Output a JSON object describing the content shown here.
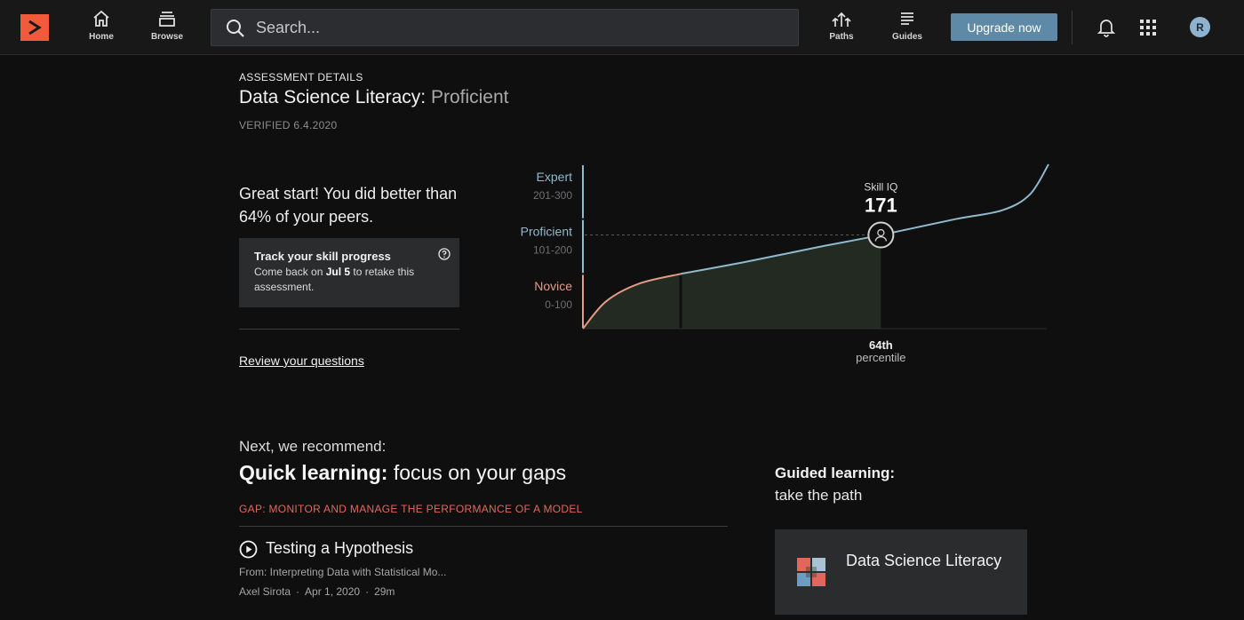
{
  "nav": {
    "home_label": "Home",
    "browse_label": "Browse",
    "paths_label": "Paths",
    "guides_label": "Guides",
    "upgrade_label": "Upgrade now",
    "avatar_initial": "R"
  },
  "search": {
    "placeholder": "Search..."
  },
  "assessment": {
    "eyebrow": "ASSESSMENT DETAILS",
    "skill_name": "Data Science Literacy:",
    "level": "Proficient",
    "verified": "VERIFIED 6.4.2020",
    "summary_prefix": "Great start! You did better than ",
    "summary_percent": "64%",
    "summary_suffix": " of your peers.",
    "track_title": "Track your skill progress",
    "track_body_prefix": "Come back on ",
    "track_date": "Jul 5",
    "track_body_suffix": " to retake this assessment.",
    "review_link": "Review your questions"
  },
  "chart_data": {
    "type": "line",
    "title": "",
    "bands": [
      {
        "name": "Expert",
        "range": "201-300",
        "color": "#8fb9cc"
      },
      {
        "name": "Proficient",
        "range": "101-200",
        "color": "#8fb9cc"
      },
      {
        "name": "Novice",
        "range": "0-100",
        "color": "#e39a86"
      }
    ],
    "marker_label": "Skill IQ",
    "skill_iq": 171,
    "percentile_value": "64th",
    "percentile_label": "percentile",
    "percentile": 64,
    "y_range": [
      0,
      300
    ],
    "x_range": [
      0,
      100
    ],
    "curve": [
      {
        "percentile": 0,
        "skill_iq": 0
      },
      {
        "percentile": 5,
        "skill_iq": 50
      },
      {
        "percentile": 12,
        "skill_iq": 82
      },
      {
        "percentile": 21,
        "skill_iq": 100
      },
      {
        "percentile": 35,
        "skill_iq": 122
      },
      {
        "percentile": 50,
        "skill_iq": 148
      },
      {
        "percentile": 64,
        "skill_iq": 171
      },
      {
        "percentile": 80,
        "skill_iq": 200
      },
      {
        "percentile": 90,
        "skill_iq": 216
      },
      {
        "percentile": 96,
        "skill_iq": 245
      },
      {
        "percentile": 100,
        "skill_iq": 300
      }
    ]
  },
  "recommend": {
    "next": "Next, we recommend:",
    "quick_bold": "Quick learning:",
    "quick_rest": " focus on your gaps",
    "gap": "GAP: MONITOR AND MANAGE THE PERFORMANCE OF A MODEL",
    "course": {
      "title": "Testing a Hypothesis",
      "from": "From: Interpreting Data with Statistical Mo...",
      "author": "Axel Sirota",
      "date": "Apr 1, 2020",
      "duration": "29m"
    },
    "guided_bold": "Guided learning:",
    "guided_sub": "take the path",
    "path_name": "Data Science Literacy"
  }
}
